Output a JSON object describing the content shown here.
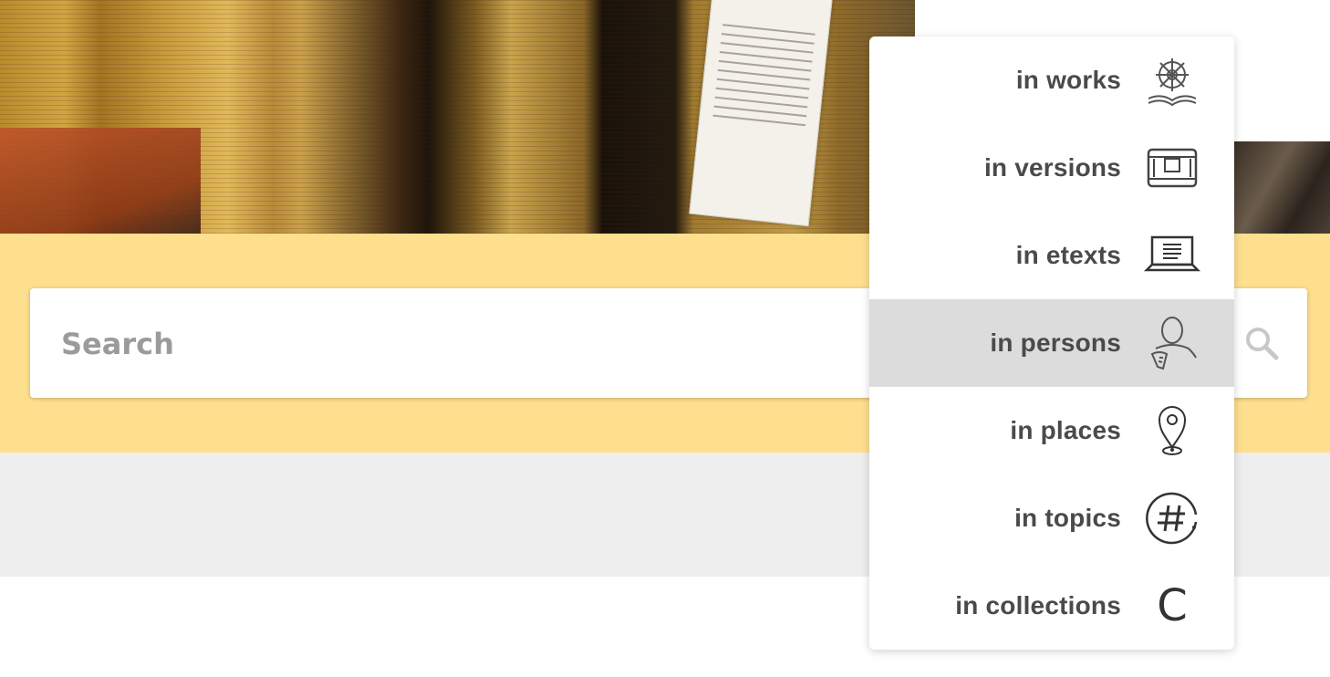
{
  "search": {
    "placeholder": "Search"
  },
  "dropdown": {
    "items": [
      {
        "label": "in works",
        "icon": "dharma-wheel-book-icon",
        "selected": false
      },
      {
        "label": "in versions",
        "icon": "text-box-icon",
        "selected": false
      },
      {
        "label": "in etexts",
        "icon": "laptop-icon",
        "selected": false
      },
      {
        "label": "in persons",
        "icon": "person-icon",
        "selected": true
      },
      {
        "label": "in places",
        "icon": "map-pin-icon",
        "selected": false
      },
      {
        "label": "in topics",
        "icon": "hashtag-icon",
        "selected": false
      },
      {
        "label": "in collections",
        "icon": "collection-icon",
        "selected": false,
        "glyph": "C"
      }
    ]
  },
  "colors": {
    "band": "#fddf8e",
    "selected": "#dcdcdc",
    "label": "#4a4a4a"
  }
}
